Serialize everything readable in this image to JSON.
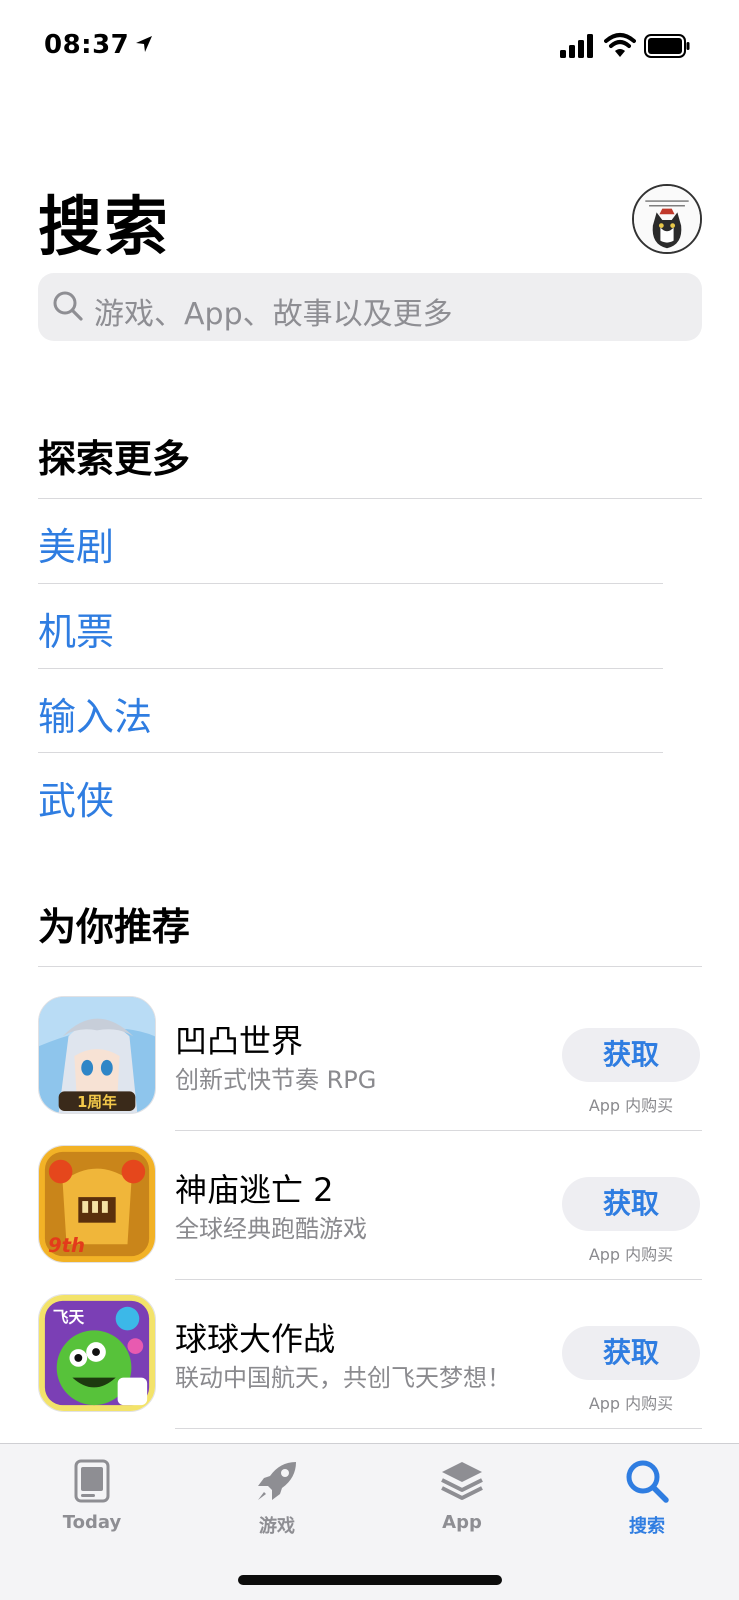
{
  "status_bar": {
    "time": "08:37"
  },
  "header": {
    "title": "搜索"
  },
  "search": {
    "placeholder": "游戏、App、故事以及更多"
  },
  "explore": {
    "title": "探索更多",
    "items": [
      "美剧",
      "机票",
      "输入法",
      "武侠"
    ]
  },
  "recommend": {
    "title": "为你推荐",
    "apps": [
      {
        "name": "凹凸世界",
        "subtitle": "创新式快节奏 RPG",
        "button": "获取",
        "note": "App 内购买",
        "badge": "1周年"
      },
      {
        "name": "神庙逃亡 2",
        "subtitle": "全球经典跑酷游戏",
        "button": "获取",
        "note": "App 内购买",
        "badge": "9th"
      },
      {
        "name": "球球大作战",
        "subtitle": "联动中国航天，共创飞天梦想！",
        "button": "获取",
        "note": "App 内购买",
        "badge": "飞天"
      }
    ]
  },
  "tabs": [
    {
      "label": "Today",
      "icon": "today-icon",
      "active": false
    },
    {
      "label": "游戏",
      "icon": "rocket-icon",
      "active": false
    },
    {
      "label": "App",
      "icon": "layers-icon",
      "active": false
    },
    {
      "label": "搜索",
      "icon": "search-icon",
      "active": true
    }
  ],
  "colors": {
    "accent": "#2f7de1",
    "search_bg": "#eeeef0",
    "tab_bg": "#f4f4f6"
  }
}
